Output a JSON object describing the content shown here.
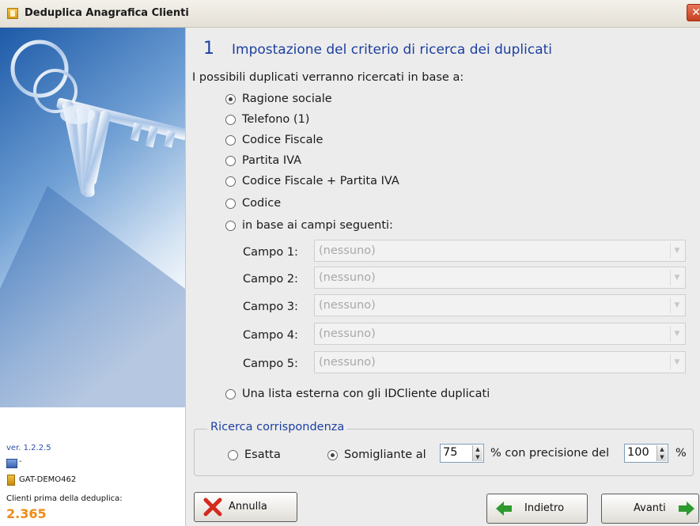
{
  "window": {
    "title": "Deduplica Anagrafica Clienti",
    "close_glyph": "✕"
  },
  "sidebar": {
    "version": "ver. 1.2.2.5",
    "computer": "-",
    "database": "GAT-DEMO462",
    "count_label": "Clienti prima della deduplica:",
    "count_value": "2.365"
  },
  "step": {
    "number": "1",
    "title": "Impostazione del criterio di ricerca dei duplicati"
  },
  "intro": "I possibili duplicati verranno ricercati in base a:",
  "criteria": [
    {
      "label": "Ragione sociale",
      "selected": true
    },
    {
      "label": "Telefono (1)",
      "selected": false
    },
    {
      "label": "Codice Fiscale",
      "selected": false
    },
    {
      "label": "Partita IVA",
      "selected": false
    },
    {
      "label": "Codice Fiscale + Partita IVA",
      "selected": false
    },
    {
      "label": "Codice",
      "selected": false
    },
    {
      "label": "in base ai campi seguenti:",
      "selected": false
    }
  ],
  "fields": [
    {
      "label": "Campo 1:",
      "value": "(nessuno)"
    },
    {
      "label": "Campo 2:",
      "value": "(nessuno)"
    },
    {
      "label": "Campo 3:",
      "value": "(nessuno)"
    },
    {
      "label": "Campo 4:",
      "value": "(nessuno)"
    },
    {
      "label": "Campo 5:",
      "value": "(nessuno)"
    }
  ],
  "external_list": {
    "label": "Una lista esterna con gli IDCliente duplicati",
    "selected": false
  },
  "match": {
    "title": "Ricerca corrispondenza",
    "exact_label": "Esatta",
    "similar_label": "Somigliante al",
    "similar_value": "75",
    "precision_label": "% con precisione del",
    "precision_value": "100",
    "percent": "%"
  },
  "buttons": {
    "cancel": "Annulla",
    "back": "Indietro",
    "next": "Avanti"
  },
  "colors": {
    "accent": "#1c3fa0",
    "count": "#f08a18",
    "cancel_icon": "#d42a1e",
    "arrow_icon": "#2e9a2e"
  },
  "icons": {
    "app": "app-icon",
    "close": "close-icon",
    "computer": "computer-icon",
    "database": "database-icon",
    "cancel": "x-icon",
    "back": "arrow-left-icon",
    "next": "arrow-right-icon"
  }
}
